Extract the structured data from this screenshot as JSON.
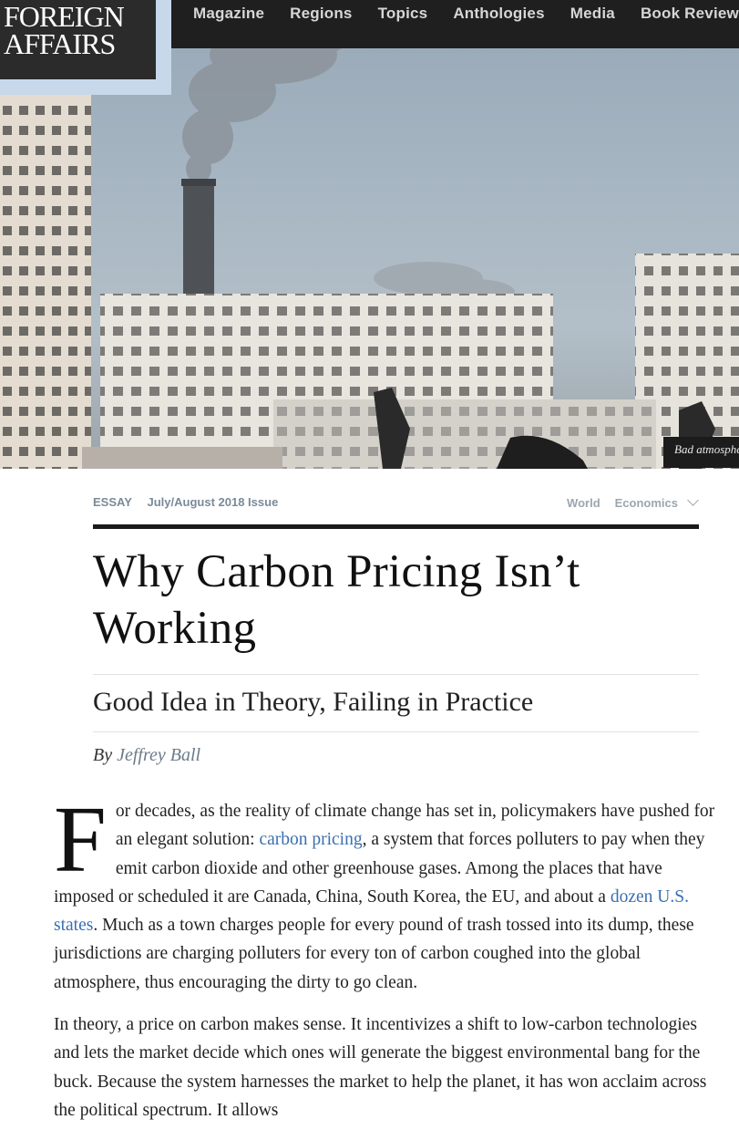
{
  "logo": {
    "line1": "FOREIGN",
    "line2": "AFFAIRS"
  },
  "nav": {
    "items": [
      "Magazine",
      "Regions",
      "Topics",
      "Anthologies",
      "Media",
      "Book Reviews"
    ]
  },
  "hero": {
    "caption": "Bad atmosphere"
  },
  "article": {
    "type": "ESSAY",
    "issue": "July/August 2018 Issue",
    "tags": [
      "World",
      "Economics"
    ],
    "title": "Why Carbon Pricing Isn’t Working",
    "subtitle": "Good Idea in Theory, Failing in Practice",
    "byline_prefix": "By",
    "author": "Jeffrey Ball",
    "p1": {
      "dropcap": "F",
      "t1": "or decades, as the reality of climate change has set in, policymakers have pushed for an elegant solution: ",
      "link1": "carbon pricing",
      "t2": ", a system that forces polluters to pay when they emit carbon dioxide and other greenhouse gases. Among the places that have imposed or scheduled it are Canada, China, South Korea, the EU, and about a ",
      "link2": "dozen U.S. states",
      "t3": ". Much as a town charges people for every pound of trash tossed into its dump, these jurisdictions are charging polluters for every ton of carbon coughed into the global atmosphere, thus encouraging the dirty to go clean."
    },
    "p2": "In theory, a price on carbon makes sense. It incentivizes a shift to low-carbon technologies and lets the market decide which ones will generate the biggest environmental bang for the buck. Because the system harnesses the market to help the planet, it has won acclaim across the political spectrum. It allows"
  }
}
